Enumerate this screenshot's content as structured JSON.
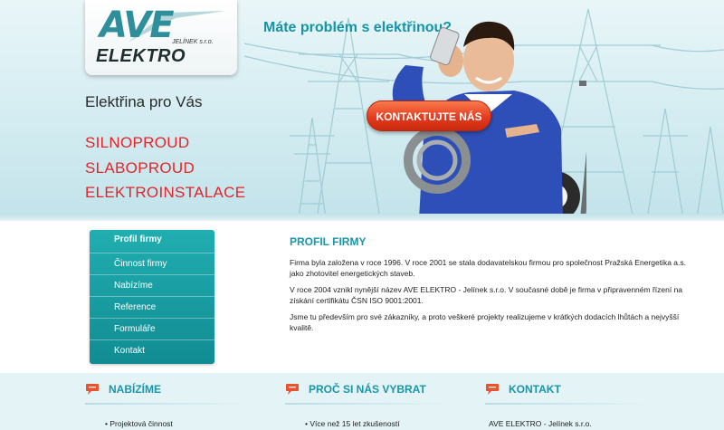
{
  "header": {
    "logo": {
      "word": "AVE",
      "owner": "JELÍNEK s.r.o.",
      "sub": "ELEKTRO"
    },
    "tagline": "Máte problém s elektřinou?",
    "title": "Elektřina pro Vás",
    "services": [
      "SILNOPROUD",
      "SLABOPROUD",
      "ELEKTROINSTALACE"
    ],
    "contact_button": "KONTAKTUJTE NÁS"
  },
  "menu": {
    "items": [
      "Profil firmy",
      "Činnost firmy",
      "Nabízíme",
      "Reference",
      "Formuláře",
      "Kontakt"
    ],
    "active": "Profil firmy"
  },
  "article": {
    "title": "PROFIL FIRMY",
    "paragraphs": [
      "Firma byla založena v roce 1996. V roce 2001 se stala dodavatelskou firmou pro společnost Pražská Energetika a.s. jako zhotovitel energetických staveb.",
      "V roce 2004 vznikl nynější název AVE ELEKTRO - Jelínek s.r.o. V současné době je firma v připravenném řízení na získání certifikátu ČSN ISO 9001:2001.",
      "Jsme tu především pro své zákazníky, a proto veškeré projekty realizujeme v krátkých dodacích lhůtách a nejvyšší kvalitě."
    ]
  },
  "footer": {
    "columns": [
      {
        "title": "NABÍZÍME",
        "first_item": "Projektová činnost"
      },
      {
        "title": "PROČ SI NÁS VYBRAT",
        "first_item": "Více než 15 let zkušeností"
      },
      {
        "title": "KONTAKT",
        "first_item": "AVE ELEKTRO - Jelínek s.r.o."
      }
    ]
  },
  "colors": {
    "accent": "#1996a9",
    "red": "#e0262b",
    "menu": "#17a0a5",
    "button": "#e53b1e"
  }
}
